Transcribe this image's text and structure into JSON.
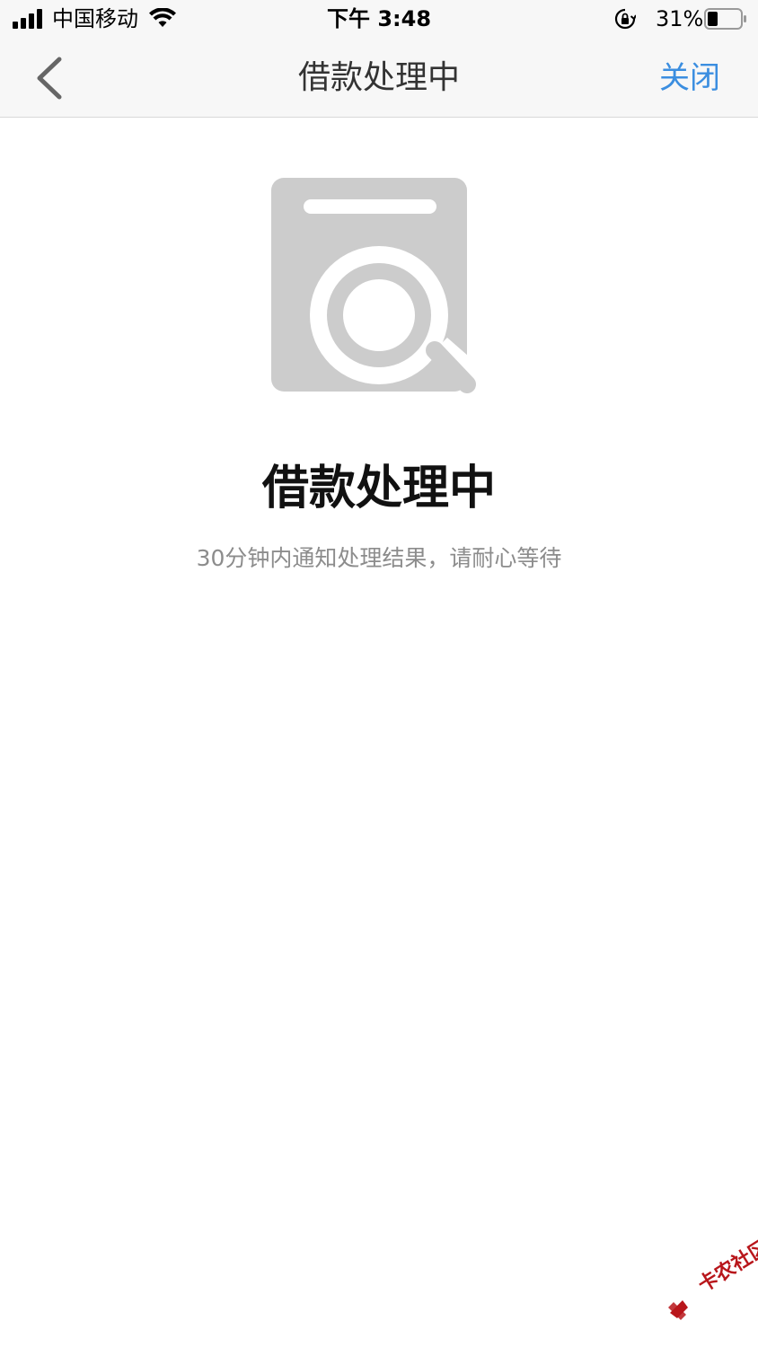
{
  "status_bar": {
    "carrier": "中国移动",
    "time": "下午 3:48",
    "battery_percent": "31%",
    "battery_level": 0.31,
    "icons": [
      "signal-icon",
      "wifi-icon",
      "orientation-lock-icon",
      "battery-icon"
    ]
  },
  "nav": {
    "title": "借款处理中",
    "close_label": "关闭",
    "accent_color": "#3b8ee0",
    "back_icon": "chevron-left-icon"
  },
  "main": {
    "illustration_icon": "document-search-icon",
    "title": "借款处理中",
    "description": "30分钟内通知处理结果，请耐心等待"
  },
  "watermark": {
    "text": "卡农社区",
    "color": "#b8161b"
  }
}
